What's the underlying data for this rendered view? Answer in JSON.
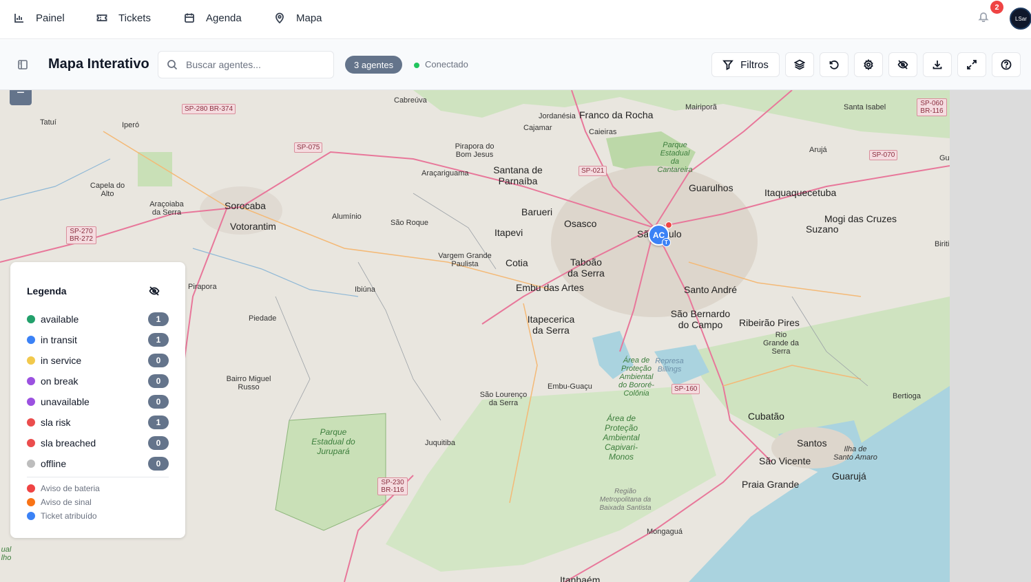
{
  "nav": {
    "items": [
      {
        "label": "Painel",
        "icon": "bar-chart-icon"
      },
      {
        "label": "Tickets",
        "icon": "ticket-icon"
      },
      {
        "label": "Agenda",
        "icon": "calendar-icon"
      },
      {
        "label": "Mapa",
        "icon": "map-pin-icon"
      }
    ],
    "notifications_count": "2",
    "avatar_text": "LSar"
  },
  "toolbar": {
    "title": "Mapa Interativo",
    "search_placeholder": "Buscar agentes...",
    "agents_pill": "3 agentes",
    "connection_status": "Conectado",
    "connection_color": "#22c55e",
    "filters_label": "Filtros"
  },
  "map": {
    "zoom_out_symbol": "−",
    "agent_marker": {
      "initials": "AC",
      "ticket_badge": "T"
    },
    "places": [
      {
        "name": "Tatuí"
      },
      {
        "name": "Iperó"
      },
      {
        "name": "Cabreúva"
      },
      {
        "name": "Jordanésia"
      },
      {
        "name": "Franco da Rocha"
      },
      {
        "name": "Mairiporã"
      },
      {
        "name": "Santa Isabel"
      },
      {
        "name": "Cajamar"
      },
      {
        "name": "Caieiras"
      },
      {
        "name": "Pirapora do Bom Jesus"
      },
      {
        "name": "Parque Estadual da Cantareira"
      },
      {
        "name": "Arujá"
      },
      {
        "name": "Capela do Alto"
      },
      {
        "name": "Araçariguama"
      },
      {
        "name": "Santana de Parnaíba"
      },
      {
        "name": "Guarulhos"
      },
      {
        "name": "Itaquaquecetuba"
      },
      {
        "name": "Araçoiaba da Serra"
      },
      {
        "name": "Sorocaba"
      },
      {
        "name": "Votorantim"
      },
      {
        "name": "Alumínio"
      },
      {
        "name": "São Roque"
      },
      {
        "name": "Barueri"
      },
      {
        "name": "Osasco"
      },
      {
        "name": "Itapevi"
      },
      {
        "name": "Suzano"
      },
      {
        "name": "Mogi das Cruzes"
      },
      {
        "name": "São Paulo"
      },
      {
        "name": "Vargem Grande Paulista"
      },
      {
        "name": "Cotia"
      },
      {
        "name": "Taboão da Serra"
      },
      {
        "name": "Pirapora"
      },
      {
        "name": "Ibiúna"
      },
      {
        "name": "Embu das Artes"
      },
      {
        "name": "Santo André"
      },
      {
        "name": "Piedade"
      },
      {
        "name": "Itapecerica da Serra"
      },
      {
        "name": "São Bernardo do Campo"
      },
      {
        "name": "Ribeirão Pires"
      },
      {
        "name": "Rio Grande da Serra"
      },
      {
        "name": "Área de Proteção Ambiental do Bororé-Colônia"
      },
      {
        "name": "Represa Billings"
      },
      {
        "name": "Bairro Miguel Russo"
      },
      {
        "name": "Embu-Guaçu"
      },
      {
        "name": "São Lourenço da Serra"
      },
      {
        "name": "Bertioga"
      },
      {
        "name": "Área de Proteção Ambiental Capivari-Monos"
      },
      {
        "name": "Parque Estadual do Jurupará"
      },
      {
        "name": "Cubatão"
      },
      {
        "name": "Juquitiba"
      },
      {
        "name": "Santos"
      },
      {
        "name": "São Vicente"
      },
      {
        "name": "Ilha de Santo Amaro"
      },
      {
        "name": "Guarujá"
      },
      {
        "name": "Praia Grande"
      },
      {
        "name": "Região Metropolitana da Baixada Santista"
      },
      {
        "name": "Mongaguá"
      },
      {
        "name": "Itanhaém"
      },
      {
        "name": "Biriti"
      },
      {
        "name": "Gua"
      },
      {
        "name": "ual lho"
      }
    ],
    "shields": [
      {
        "label": "SP-280 BR-374"
      },
      {
        "label": "SP-075"
      },
      {
        "label": "SP-021"
      },
      {
        "label": "SP-060 BR-116"
      },
      {
        "label": "SP-070"
      },
      {
        "label": "SP-270 BR-272"
      },
      {
        "label": "SP-160"
      },
      {
        "label": "SP-230 BR-116"
      }
    ]
  },
  "legend": {
    "title": "Legenda",
    "statuses": [
      {
        "label": "available",
        "count": "1",
        "color": "#22a06b"
      },
      {
        "label": "in transit",
        "count": "1",
        "color": "#3b82f6"
      },
      {
        "label": "in service",
        "count": "0",
        "color": "#f2c94c"
      },
      {
        "label": "on break",
        "count": "0",
        "color": "#9b51e0"
      },
      {
        "label": "unavailable",
        "count": "0",
        "color": "#9b51e0"
      },
      {
        "label": "sla risk",
        "count": "1",
        "color": "#eb4d4d"
      },
      {
        "label": "sla breached",
        "count": "0",
        "color": "#eb4d4d"
      },
      {
        "label": "offline",
        "count": "0",
        "color": "#bdbdbd"
      }
    ],
    "indicators": [
      {
        "label": "Aviso de bateria",
        "color": "#ef4444"
      },
      {
        "label": "Aviso de sinal",
        "color": "#f97316"
      },
      {
        "label": "Ticket atribuído",
        "color": "#3b82f6"
      }
    ]
  }
}
